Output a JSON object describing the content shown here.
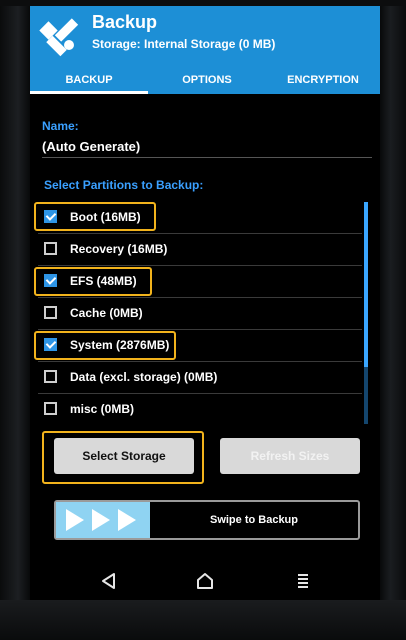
{
  "header": {
    "title": "Backup",
    "subtitle": "Storage: Internal Storage (0 MB)",
    "brand_color": "#1d8fd6",
    "logo_icon": "twrp-logo-icon"
  },
  "tabs": [
    {
      "label": "BACKUP",
      "selected": true
    },
    {
      "label": "OPTIONS",
      "selected": false
    },
    {
      "label": "ENCRYPTION",
      "selected": false
    }
  ],
  "name": {
    "label": "Name:",
    "value": "(Auto Generate)"
  },
  "partitions": {
    "label": "Select Partitions to Backup:",
    "items": [
      {
        "label": "Boot (16MB)",
        "checked": true,
        "highlighted": true
      },
      {
        "label": "Recovery (16MB)",
        "checked": false,
        "highlighted": false
      },
      {
        "label": "EFS (48MB)",
        "checked": true,
        "highlighted": true
      },
      {
        "label": "Cache (0MB)",
        "checked": false,
        "highlighted": false
      },
      {
        "label": "System (2876MB)",
        "checked": true,
        "highlighted": true
      },
      {
        "label": "Data (excl. storage) (0MB)",
        "checked": false,
        "highlighted": false
      },
      {
        "label": "misc (0MB)",
        "checked": false,
        "highlighted": false
      }
    ]
  },
  "buttons": {
    "select_storage": "Select Storage",
    "refresh_sizes": "Refresh Sizes"
  },
  "swipe": {
    "label": "Swipe to Backup"
  },
  "navbar": {
    "back_icon": "back-triangle-icon",
    "home_icon": "home-icon",
    "menu_icon": "menu-icon"
  },
  "colors": {
    "accent": "#3aa0ff",
    "highlight": "#f2b31c",
    "checkbox": "#2e95e6"
  }
}
